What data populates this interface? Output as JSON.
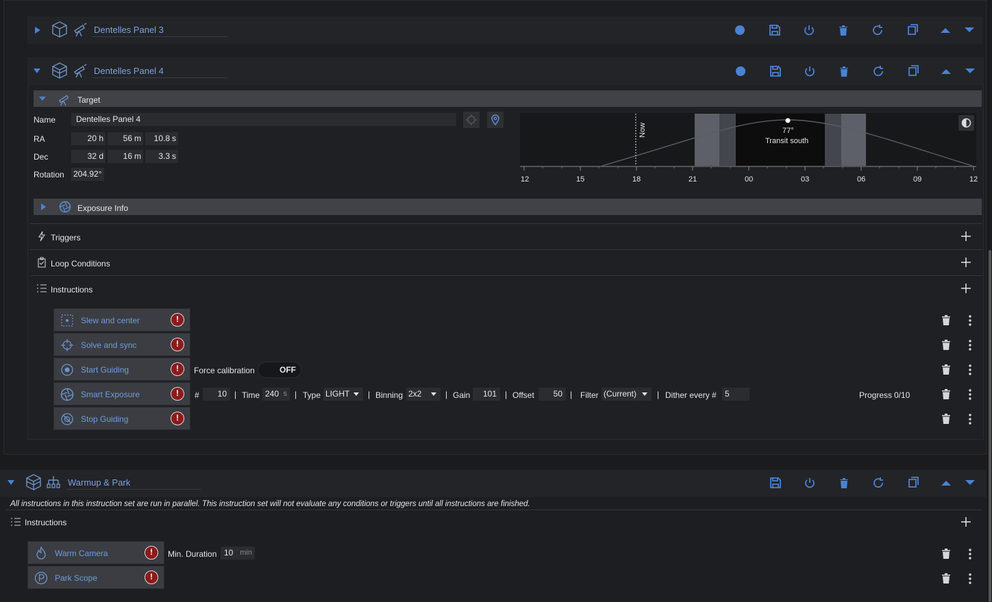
{
  "colors": {
    "accent": "#4a82d4",
    "warn": "#8c1b1b",
    "background": "#1b1b1d"
  },
  "panel3": {
    "name": "Dentelles Panel 3"
  },
  "panel4": {
    "name": "Dentelles Panel 4",
    "target": {
      "section_label": "Target",
      "name_label": "Name",
      "name_value": "Dentelles Panel 4",
      "ra_label": "RA",
      "ra_h": "20",
      "ra_h_unit": "h",
      "ra_m": "56",
      "ra_m_unit": "m",
      "ra_s": "10.8",
      "ra_s_unit": "s",
      "dec_label": "Dec",
      "dec_d": "32",
      "dec_d_unit": "d",
      "dec_m": "16",
      "dec_m_unit": "m",
      "dec_s": "3.3",
      "dec_s_unit": "s",
      "rotation_label": "Rotation",
      "rotation_value": "204.92°"
    },
    "altitude_chart": {
      "now_label": "Now",
      "transit_alt": "77°",
      "transit_label": "Transit south",
      "ticks": [
        "12",
        "15",
        "18",
        "21",
        "00",
        "03",
        "06",
        "09",
        "12"
      ]
    },
    "exposure_info_label": "Exposure Info",
    "triggers_label": "Triggers",
    "loop_conditions_label": "Loop Conditions",
    "instructions_label": "Instructions",
    "instructions": [
      {
        "label": "Slew and center",
        "icon": "crosshair-icon"
      },
      {
        "label": "Solve and sync",
        "icon": "target-icon"
      },
      {
        "label": "Start Guiding",
        "icon": "guide-start-icon"
      },
      {
        "label": "Smart Exposure",
        "icon": "aperture-icon"
      },
      {
        "label": "Stop Guiding",
        "icon": "guide-stop-icon"
      }
    ],
    "guiding": {
      "force_label": "Force calibration",
      "force_value": "OFF"
    },
    "smart_exposure": {
      "count_label": "#",
      "count": "10",
      "time_label": "Time",
      "time": "240",
      "time_unit": "s",
      "type_label": "Type",
      "type": "LIGHT",
      "binning_label": "Binning",
      "binning": "2x2",
      "gain_label": "Gain",
      "gain": "101",
      "offset_label": "Offset",
      "offset": "50",
      "filter_label": "Filter",
      "filter": "(Current)",
      "dither_label": "Dither every #",
      "dither": "5",
      "progress_label": "Progress",
      "progress": "0/10",
      "sep": "|"
    }
  },
  "warmup": {
    "name": "Warmup & Park",
    "note": "All instructions in this instruction set are run in parallel. This instruction set will not evaluate any conditions or triggers until all instructions are finished.",
    "instructions_label": "Instructions",
    "instructions": [
      {
        "label": "Warm Camera",
        "icon": "flame-icon"
      },
      {
        "label": "Park Scope",
        "icon": "park-icon"
      }
    ],
    "min_duration_label": "Min. Duration",
    "min_duration": "10",
    "min_duration_unit": "min"
  }
}
